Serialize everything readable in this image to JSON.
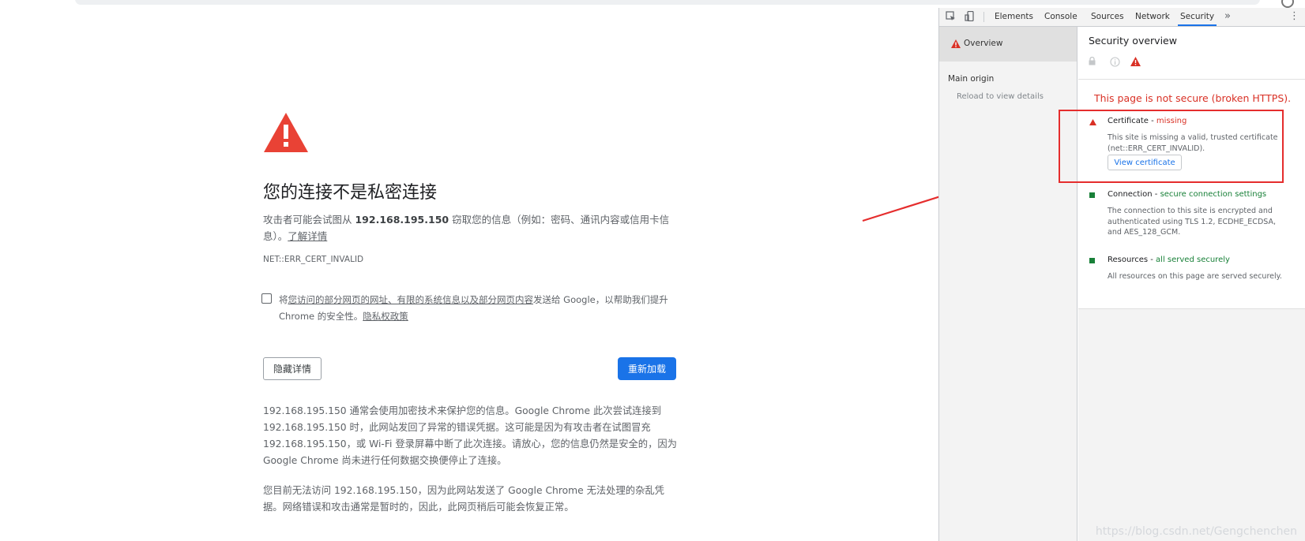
{
  "interstitial": {
    "heading": "您的连接不是私密连接",
    "para1_before": "攻击者可能会试图从 ",
    "para1_host": "192.168.195.150",
    "para1_after": " 窃取您的信息（例如：密码、通讯内容或信用卡信息）。",
    "learn_more": "了解详情",
    "error_code": "NET::ERR_CERT_INVALID",
    "checkbox_prefix": "将",
    "checkbox_link": "您访问的部分网页的网址、有限的系统信息以及部分网页内容",
    "checkbox_suffix": "发送给 Google，以帮助我们提升 Chrome 的安全性。",
    "privacy_link": "隐私权政策",
    "hide_details_button": "隐藏详情",
    "reload_button": "重新加载",
    "details_para1": "192.168.195.150 通常会使用加密技术来保护您的信息。Google Chrome 此次尝试连接到 192.168.195.150 时，此网站发回了异常的错误凭据。这可能是因为有攻击者在试图冒充 192.168.195.150，或 Wi-Fi 登录屏幕中断了此次连接。请放心，您的信息仍然是安全的，因为 Google Chrome 尚未进行任何数据交换便停止了连接。",
    "details_para2": "您目前无法访问 192.168.195.150，因为此网站发送了 Google Chrome 无法处理的杂乱凭据。网络错误和攻击通常是暂时的，因此，此网页稍后可能会恢复正常。"
  },
  "devtools": {
    "tabs": [
      "Elements",
      "Console",
      "Sources",
      "Network",
      "Security"
    ],
    "active_tab": "Security",
    "sidebar": {
      "overview": "Overview",
      "main_origin": "Main origin",
      "reload_hint": "Reload to view details"
    },
    "overview": {
      "title": "Security overview",
      "summary": "This page is not secure (broken HTTPS).",
      "certificate": {
        "label": "Certificate - ",
        "status": "missing",
        "description": "This site is missing a valid, trusted certificate (net::ERR_CERT_INVALID).",
        "button": "View certificate"
      },
      "connection": {
        "label": "Connection - ",
        "status": "secure connection settings",
        "description": "The connection to this site is encrypted and authenticated using TLS 1.2, ECDHE_ECDSA, and AES_128_GCM."
      },
      "resources": {
        "label": "Resources - ",
        "status": "all served securely",
        "description": "All resources on this page are served securely."
      }
    }
  },
  "watermark": "https://blog.csdn.net/Gengchenchen",
  "colors": {
    "warning_red": "#d93025",
    "secure_green": "#188038",
    "primary_blue": "#1a73e8",
    "annotation_red": "#e52d2d"
  }
}
